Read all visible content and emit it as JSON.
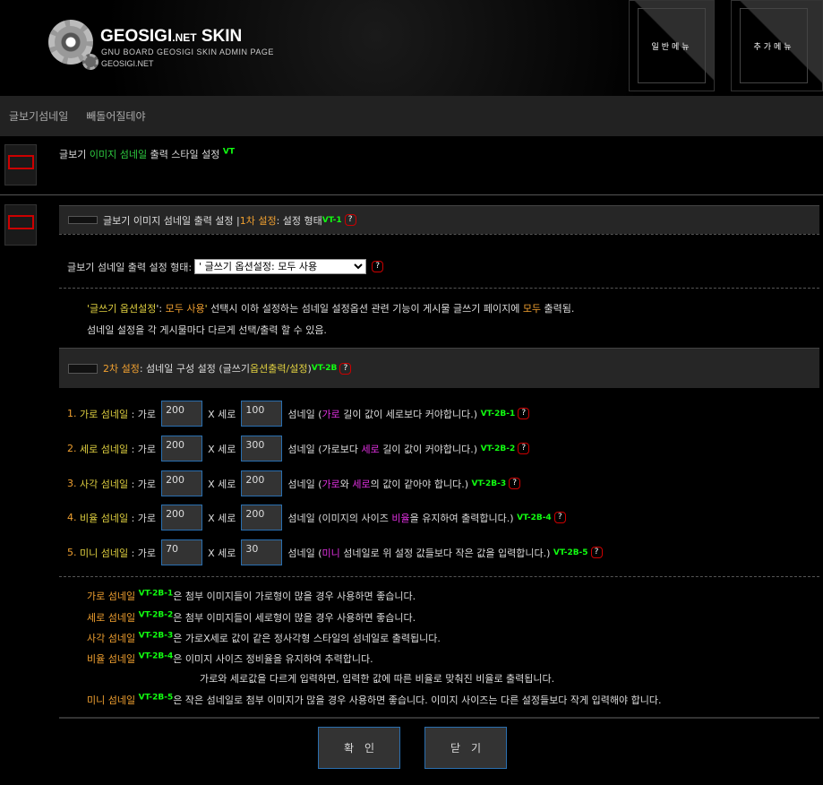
{
  "header": {
    "logo_title": "GEOSIGI",
    "logo_net": ".NET",
    "logo_skin": "SKIN",
    "logo_subtitle": "GNU BOARD GEOSIGI SKIN ADMIN PAGE",
    "logo_site": "GEOSIGI.NET",
    "menu_general": "일반메뉴",
    "menu_extra": "추가메뉴"
  },
  "nav": {
    "items": [
      "글보기섬네일",
      "빼돌어질테야"
    ]
  },
  "page_title": {
    "p1": "글보기 ",
    "p2": "이미지 섬네일",
    "p3": " 출력 스타일 설정 ",
    "vt": "VT"
  },
  "section1": {
    "p1": "글보기 이미지 섬네일 출력 설정 | ",
    "p2": "1차 설정",
    "p3": " : 설정 형태 ",
    "vt": "VT-1",
    "select_label": "글보기 섬네일 출력 설정 형태:",
    "select_value": "' 글쓰기 옵션설정: 모두 사용",
    "note1": [
      [
        "y",
        "'글쓰기 옵션설정"
      ],
      [
        "",
        "': "
      ],
      [
        "o",
        "모두 사용"
      ],
      [
        "y",
        "'"
      ],
      [
        "",
        " 선택시 이하 설정하는 섬네일 설정옵션 관련 기능이 게시물 글쓰기 페이지에 "
      ],
      [
        "o",
        "모두"
      ],
      [
        "",
        " 출력됨."
      ]
    ],
    "note2": "섬네일 설정을 각 게시물마다 다르게 선택/출력 할 수 있음."
  },
  "section2": {
    "p1": "2차 설정",
    "p2": " : 섬네일 구성 설정 (글쓰기 ",
    "p3": "옵션출력/설정",
    "p4": ")",
    "vt": "VT-2B"
  },
  "rows": [
    {
      "num": "1.",
      "label": "가로 섬네일",
      "w_label": ": 가로",
      "width": "200",
      "x_label": "X 세로",
      "height": "100",
      "desc": [
        [
          "",
          "섬네일 ("
        ],
        [
          "m",
          "가로"
        ],
        [
          "",
          " 길이 값이 세로보다 커야합니다.)"
        ]
      ],
      "vt": "VT-2B-1"
    },
    {
      "num": "2.",
      "label": "세로 섬네일",
      "w_label": ": 가로",
      "width": "200",
      "x_label": "X 세로",
      "height": "300",
      "desc": [
        [
          "",
          "섬네일 (가로보다 "
        ],
        [
          "m",
          "세로"
        ],
        [
          "",
          " 길이 값이 커야합니다.)"
        ]
      ],
      "vt": "VT-2B-2"
    },
    {
      "num": "3.",
      "label": "사각 섬네일",
      "w_label": ": 가로",
      "width": "200",
      "x_label": "X 세로",
      "height": "200",
      "desc": [
        [
          "",
          "섬네일 ("
        ],
        [
          "m",
          "가로"
        ],
        [
          "",
          "와 "
        ],
        [
          "m",
          "세로"
        ],
        [
          "",
          "의 값이 같아야 합니다.)"
        ]
      ],
      "vt": "VT-2B-3"
    },
    {
      "num": "4.",
      "label": "비율 섬네일",
      "w_label": ": 가로",
      "width": "200",
      "x_label": "X 세로",
      "height": "200",
      "desc": [
        [
          "",
          "섬네일 (이미지의 사이즈 "
        ],
        [
          "m",
          "비율"
        ],
        [
          "",
          "을 유지하여 출력합니다.)"
        ]
      ],
      "vt": "VT-2B-4"
    },
    {
      "num": "5.",
      "label": "미니 섬네일",
      "w_label": ": 가로",
      "width": "70",
      "x_label": "X 세로",
      "height": "30",
      "desc": [
        [
          "",
          "섬네일 ("
        ],
        [
          "m",
          "미니"
        ],
        [
          "",
          " 섬네일로 위 설정 값들보다 작은 값을 입력합니다.)"
        ]
      ],
      "vt": "VT-2B-5"
    }
  ],
  "notes": [
    {
      "label": "가로 섬네일",
      "vt": "VT-2B-1",
      "text": "은 첨부 이미지들이 가로형이 많을 경우 사용하면 좋습니다."
    },
    {
      "label": "세로 섬네일",
      "vt": "VT-2B-2",
      "text": "은 첨부 이미지들이 세로형이 많을 경우 사용하면 좋습니다."
    },
    {
      "label": "사각 섬네일",
      "vt": "VT-2B-3",
      "text": "은 가로X세로 값이 같은 정사각형 스타일의 섬네일로 출력됩니다."
    },
    {
      "label": "비율 섬네일",
      "vt": "VT-2B-4",
      "text": "은 이미지 사이즈 정비율을 유지하여 추력합니다."
    },
    {
      "label": "",
      "vt": "",
      "text": "가로와 세로값을 다르게 입력하면, 입력한 값에 따른 비율로 맞춰진 비율로 출력됩니다."
    },
    {
      "label": "미니 섬네일",
      "vt": "VT-2B-5",
      "text": "은 작은 섬네일로 첨부 이미지가 많을 경우 사용하면 좋습니다. 이미지 사이즈는 다른 설정들보다 작게 입력해야 합니다."
    }
  ],
  "buttons": {
    "confirm": "확인",
    "close": "닫기"
  },
  "help_glyph": "?"
}
